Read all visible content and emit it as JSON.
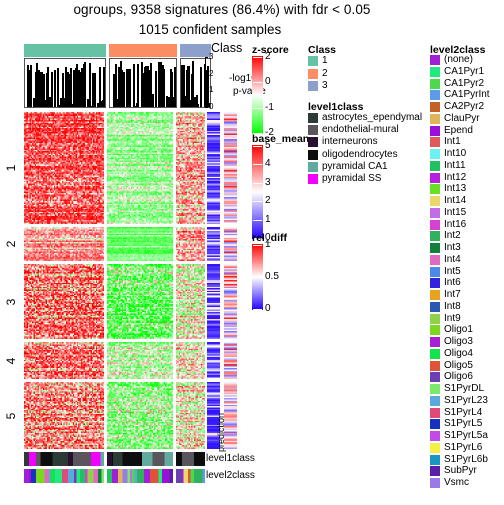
{
  "title": {
    "main": "ogroups, 9358 signatures (86.4%) with fdr < 0.05",
    "sub": "1015 confident samples"
  },
  "top_annotation": {
    "class_label": "Class",
    "barplot_axis_label_line1": "-log10",
    "barplot_axis_label_line2": "p-value",
    "barplot_axis_ticks": [
      "3",
      "2",
      "1",
      "0"
    ],
    "class_blocks": [
      {
        "label": "1",
        "color": "#66c2a5",
        "width_frac": 0.455
      },
      {
        "label": "2",
        "color": "#fc8d62",
        "width_frac": 0.375
      },
      {
        "label": "3",
        "color": "#8da0cb",
        "width_frac": 0.17
      }
    ]
  },
  "prediction_label": "prediction",
  "row_labels": [
    "1",
    "2",
    "3",
    "4",
    "5"
  ],
  "legends": {
    "z_score": {
      "title": "z-score",
      "ticks": [
        "2",
        "0",
        "-1",
        "-2"
      ],
      "colors": {
        "high": "#ff0000",
        "mid": "#ffffff",
        "low": "#00ff00"
      }
    },
    "base_mean": {
      "title": "base_mean",
      "ticks": [
        "5",
        "4",
        "3",
        "2",
        "1",
        "0"
      ],
      "colors": {
        "high": "#ff0000",
        "mid": "#ffffff",
        "low": "#2000ff"
      }
    },
    "rel_diff": {
      "title": "rel_diff",
      "ticks": [
        "1",
        "0.5",
        "0"
      ],
      "colors": {
        "high": "#ff0000",
        "mid": "#ffffff",
        "low": "#2000ff"
      }
    },
    "class": {
      "title": "Class",
      "items": [
        {
          "label": "1",
          "color": "#66c2a5"
        },
        {
          "label": "2",
          "color": "#fc8d62"
        },
        {
          "label": "3",
          "color": "#8da0cb"
        }
      ]
    },
    "level1class": {
      "title": "level1class",
      "items": [
        {
          "label": "astrocytes_ependymal",
          "color": "#2c3b35"
        },
        {
          "label": "endothelial-mural",
          "color": "#5a545c"
        },
        {
          "label": "interneurons",
          "color": "#2a1030"
        },
        {
          "label": "oligodendrocytes",
          "color": "#0d0d0d"
        },
        {
          "label": "pyramidal CA1",
          "color": "#62a99e"
        },
        {
          "label": "pyramidal SS",
          "color": "#f200ff"
        }
      ]
    },
    "level2class": {
      "title": "level2class",
      "items": [
        {
          "label": "(none)",
          "color": "#a11fd4"
        },
        {
          "label": "CA1Pyr1",
          "color": "#21e97f"
        },
        {
          "label": "CA1Pyr2",
          "color": "#4cd94c"
        },
        {
          "label": "CA1PyrInt",
          "color": "#5b9bea"
        },
        {
          "label": "CA2Pyr2",
          "color": "#c2622a"
        },
        {
          "label": "ClauPyr",
          "color": "#e0b45a"
        },
        {
          "label": "Epend",
          "color": "#9a10d8"
        },
        {
          "label": "Int1",
          "color": "#e05a5a"
        },
        {
          "label": "Int10",
          "color": "#6df0f0"
        },
        {
          "label": "Int11",
          "color": "#21c063"
        },
        {
          "label": "Int12",
          "color": "#b61fe0"
        },
        {
          "label": "Int13",
          "color": "#6ae024"
        },
        {
          "label": "Int14",
          "color": "#ead66b"
        },
        {
          "label": "Int15",
          "color": "#c26ce8"
        },
        {
          "label": "Int16",
          "color": "#d93fd0"
        },
        {
          "label": "Int2",
          "color": "#2fb25b"
        },
        {
          "label": "Int3",
          "color": "#12803a"
        },
        {
          "label": "Int4",
          "color": "#e06ac0"
        },
        {
          "label": "Int5",
          "color": "#4a8ae8"
        },
        {
          "label": "Int6",
          "color": "#3322e0"
        },
        {
          "label": "Int7",
          "color": "#e8a31c"
        },
        {
          "label": "Int8",
          "color": "#2a5ab0"
        },
        {
          "label": "Int9",
          "color": "#8fd14a"
        },
        {
          "label": "Oligo1",
          "color": "#7ad91f"
        },
        {
          "label": "Oligo3",
          "color": "#a81fd4"
        },
        {
          "label": "Oligo4",
          "color": "#12e54a"
        },
        {
          "label": "Oligo5",
          "color": "#e0523a"
        },
        {
          "label": "Oligo6",
          "color": "#6a3fb2"
        },
        {
          "label": "S1PyrDL",
          "color": "#7aea6a"
        },
        {
          "label": "S1PyrL23",
          "color": "#59a8de"
        },
        {
          "label": "S1PyrL4",
          "color": "#e04a78"
        },
        {
          "label": "S1PyrL5",
          "color": "#1533c0"
        },
        {
          "label": "S1PyrL5a",
          "color": "#c24ae8"
        },
        {
          "label": "S1PyrL6",
          "color": "#f5f045"
        },
        {
          "label": "S1PyrL6b",
          "color": "#1898c0"
        },
        {
          "label": "SubPyr",
          "color": "#5a1fa8"
        },
        {
          "label": "Vsmc",
          "color": "#9a7ae8"
        }
      ]
    }
  },
  "bottom_annotation": {
    "level1class_label": "level1class",
    "level2class_label": "level2class"
  }
}
